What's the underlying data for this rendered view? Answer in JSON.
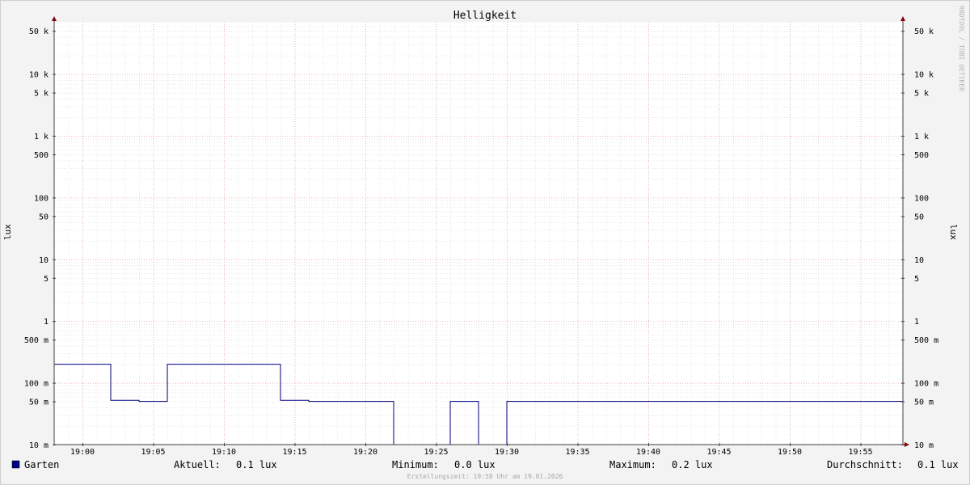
{
  "chart_data": {
    "type": "line",
    "title": "Helligkeit",
    "ylabel": "lux",
    "y_scale": "log",
    "ylim": [
      0.01,
      70000
    ],
    "xlim": [
      "18:58",
      "19:58"
    ],
    "x_ticks": [
      "19:00",
      "19:05",
      "19:10",
      "19:15",
      "19:20",
      "19:25",
      "19:30",
      "19:35",
      "19:40",
      "19:45",
      "19:50",
      "19:55"
    ],
    "y_ticks": [
      {
        "value": 50000,
        "label": "50 k"
      },
      {
        "value": 10000,
        "label": "10 k"
      },
      {
        "value": 5000,
        "label": "5 k"
      },
      {
        "value": 1000,
        "label": "1 k"
      },
      {
        "value": 500,
        "label": "500"
      },
      {
        "value": 100,
        "label": "100"
      },
      {
        "value": 50,
        "label": "50"
      },
      {
        "value": 10,
        "label": "10"
      },
      {
        "value": 5,
        "label": "5"
      },
      {
        "value": 1,
        "label": "1"
      },
      {
        "value": 0.5,
        "label": "500 m"
      },
      {
        "value": 0.1,
        "label": "100 m"
      },
      {
        "value": 0.05,
        "label": "50 m"
      },
      {
        "value": 0.01,
        "label": "10 m"
      }
    ],
    "grid": true,
    "series": [
      {
        "name": "Garten",
        "color": "#000080",
        "step": true,
        "points": [
          {
            "x": "18:58",
            "y": 0.2
          },
          {
            "x": "19:02",
            "y": 0.052
          },
          {
            "x": "19:04",
            "y": 0.05
          },
          {
            "x": "19:06",
            "y": 0.2
          },
          {
            "x": "19:14",
            "y": 0.052
          },
          {
            "x": "19:16",
            "y": 0.05
          },
          {
            "x": "19:22",
            "y": 0.01
          },
          {
            "x": "19:26",
            "y": 0.05
          },
          {
            "x": "19:28",
            "y": 0.01
          },
          {
            "x": "19:30",
            "y": 0.05
          },
          {
            "x": "19:58",
            "y": 0.05
          }
        ]
      }
    ]
  },
  "legend": {
    "series_name": "Garten",
    "swatch_color": "#000080",
    "current_label": "Aktuell:",
    "current_value": "0.1 lux",
    "min_label": "Minimum:",
    "min_value": "0.0 lux",
    "max_label": "Maximum:",
    "max_value": "0.2 lux",
    "avg_label": "Durchschnitt:",
    "avg_value": "0.1 lux"
  },
  "footer": "Erstellungszeit: 19:58 Uhr am 19.01.2026",
  "watermark": "RRDTOOL / TOBI OETIKER"
}
